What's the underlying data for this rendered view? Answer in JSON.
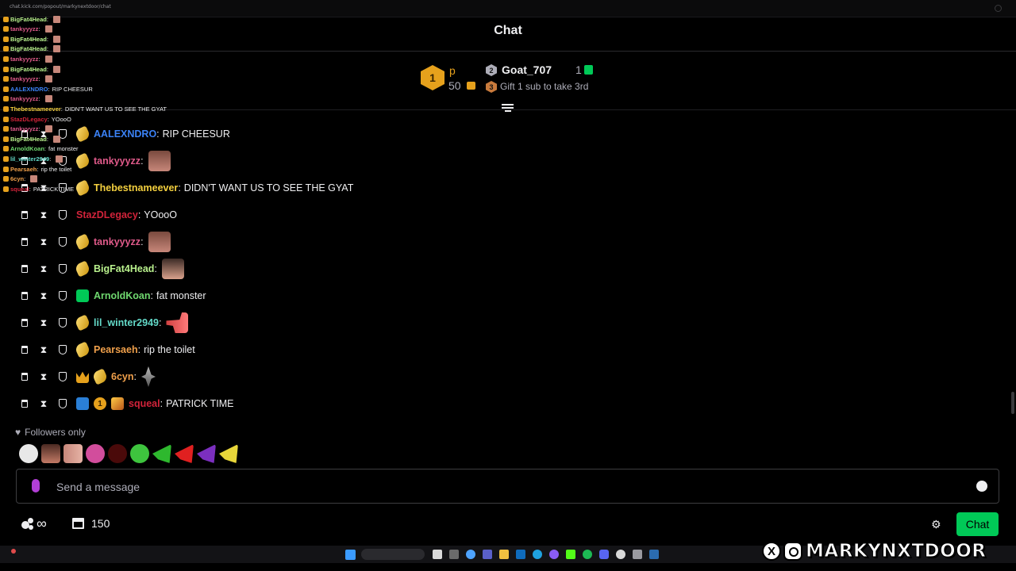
{
  "browser": {
    "url": "chat.kick.com/popout/markynextdoor/chat"
  },
  "header": {
    "title": "Chat"
  },
  "leaderboard": {
    "first": {
      "rank": "1",
      "name": "p",
      "count": "50"
    },
    "second": {
      "rank": "2",
      "name": "Goat_707",
      "count": "1"
    },
    "third": {
      "rank": "3",
      "text": "Gift 1 sub to take 3rd"
    }
  },
  "messages": [
    {
      "user": "AALEXNDRO",
      "color": "#3b82f6",
      "text": "RIP CHEESUR",
      "emote": ""
    },
    {
      "user": "tankyyyzz",
      "color": "#e05a8a",
      "text": "",
      "emote": "tanky"
    },
    {
      "user": "Thebestnameever",
      "color": "#f4d03f",
      "text": "DIDN'T WANT US TO SEE THE GYAT",
      "emote": ""
    },
    {
      "user": "StazDLegacy",
      "color": "#d1233a",
      "text": "YOooO",
      "emote": ""
    },
    {
      "user": "tankyyyzz",
      "color": "#e05a8a",
      "text": "",
      "emote": "tanky"
    },
    {
      "user": "BigFat4Head",
      "color": "#b9f18d",
      "text": "",
      "emote": "face"
    },
    {
      "user": "ArnoldKoan",
      "color": "#6fd86f",
      "text": "fat monster",
      "emote": ""
    },
    {
      "user": "lil_winter2949",
      "color": "#63d9c8",
      "text": "",
      "emote": "point"
    },
    {
      "user": "Pearsaeh",
      "color": "#f0a04b",
      "text": "rip the toilet",
      "emote": ""
    },
    {
      "user": "6cyn",
      "color": "#f0a04b",
      "text": "",
      "emote": "sparkle"
    },
    {
      "user": "squeal",
      "color": "#d1233a",
      "text": "PATRICK TIME",
      "emote": ""
    }
  ],
  "overlay_lines": [
    {
      "user": "BigFat4Head",
      "color": "#b9f18d",
      "text": ""
    },
    {
      "user": "tankyyyzz",
      "color": "#e05a8a",
      "text": ""
    },
    {
      "user": "BigFat4Head",
      "color": "#b9f18d",
      "text": ""
    },
    {
      "user": "BigFat4Head",
      "color": "#b9f18d",
      "text": ""
    },
    {
      "user": "tankyyyzz",
      "color": "#e05a8a",
      "text": ""
    },
    {
      "user": "BigFat4Head",
      "color": "#b9f18d",
      "text": ""
    },
    {
      "user": "tankyyyzz",
      "color": "#e05a8a",
      "text": ""
    },
    {
      "user": "AALEXNDRO",
      "color": "#3b82f6",
      "text": "RIP CHEESUR"
    },
    {
      "user": "tankyyyzz",
      "color": "#e05a8a",
      "text": ""
    },
    {
      "user": "Thebestnameever",
      "color": "#f4d03f",
      "text": "DIDN'T WANT US TO SEE THE GYAT"
    },
    {
      "user": "StazDLegacy",
      "color": "#d1233a",
      "text": "YOooO"
    },
    {
      "user": "tankyyyzz",
      "color": "#e05a8a",
      "text": ""
    },
    {
      "user": "BigFat4Head",
      "color": "#b9f18d",
      "text": ""
    },
    {
      "user": "ArnoldKoan",
      "color": "#6fd86f",
      "text": "fat monster"
    },
    {
      "user": "lil_winter2949",
      "color": "#63d9c8",
      "text": ""
    },
    {
      "user": "Pearsaeh",
      "color": "#f0a04b",
      "text": "rip the toilet"
    },
    {
      "user": "6cyn",
      "color": "#f0a04b",
      "text": ""
    },
    {
      "user": "squeal",
      "color": "#d1233a",
      "text": "PATRICK TIME"
    }
  ],
  "chat_mode": {
    "label": "Followers only"
  },
  "input": {
    "placeholder": "Send a message"
  },
  "footer": {
    "infinity": "∞",
    "points": "150",
    "chat_button": "Chat"
  },
  "watermark": {
    "x": "X",
    "handle": "MARKYNXTDOOR"
  },
  "colors": {
    "accent": "#00c957",
    "gold": "#e6a11c",
    "silver": "#adadb8",
    "bronze": "#c87a3c",
    "background": "#000000"
  }
}
